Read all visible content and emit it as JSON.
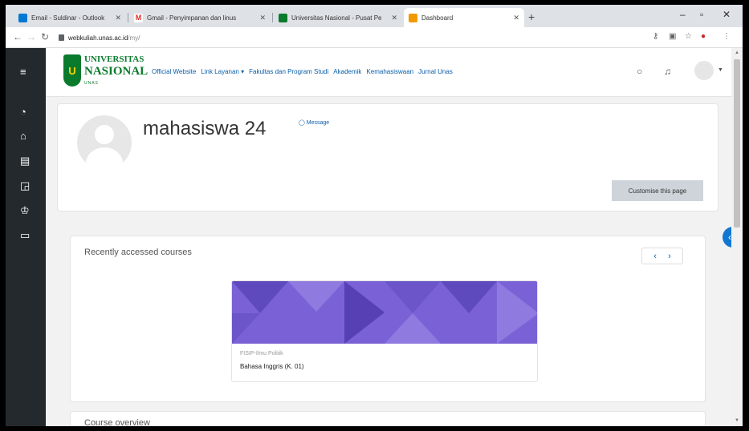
{
  "browser": {
    "tabs": [
      {
        "label": "Email - Suldinar - Outlook",
        "color": "#0078d4"
      },
      {
        "label": "Gmail - Penyimpanan dan linus",
        "color": "#d93025"
      },
      {
        "label": "Universitas Nasional - Pusat Pe",
        "color": "#0a7a2c"
      },
      {
        "label": "Dashboard",
        "color": "#f29900"
      }
    ],
    "url_host": "webkuliah.unas.ac.id",
    "url_path": "/my/"
  },
  "brand": {
    "logo_line1": "UNIVERSITAS",
    "logo_line2": "NASIONAL",
    "logo_line3": "UNAS"
  },
  "nav": {
    "items": [
      "Official Website",
      "Link Layanan",
      "Fakultas dan Program Studi",
      "Akademik",
      "Kemahasiswaan",
      "Jurnal Unas"
    ]
  },
  "profile": {
    "name": "mahasiswa 24",
    "message_label": "Message",
    "customise_label": "Customise this page"
  },
  "recent": {
    "title": "Recently accessed courses",
    "course_category": "FISIP-Ilmu Politik",
    "course_name": "Bahasa Inggris (K. 01)"
  },
  "overview": {
    "title": "Course overview"
  }
}
